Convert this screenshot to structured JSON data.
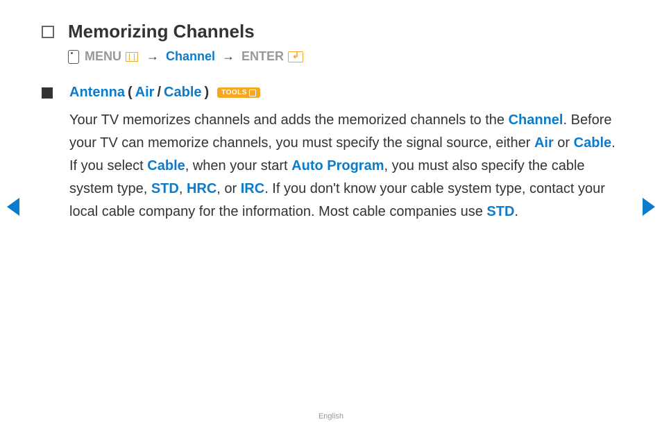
{
  "title": "Memorizing Channels",
  "nav": {
    "menu": "MENU",
    "channel": "Channel",
    "enter": "ENTER",
    "arrow": "→"
  },
  "section": {
    "antenna": "Antenna",
    "open_paren": "(",
    "air": "Air",
    "slash": " / ",
    "cable": "Cable",
    "close_paren": ")",
    "tools": "TOOLS"
  },
  "body": {
    "t1": "Your TV memorizes channels and adds the memorized channels to the ",
    "channel": "Channel",
    "t2": ". Before your TV can memorize channels, you must specify the signal source, either ",
    "air": "Air",
    "t3": " or ",
    "cable": "Cable",
    "t4": ". If you select ",
    "cable2": "Cable",
    "t5": ", when your start ",
    "autoprogram": "Auto Program",
    "t6": ", you must also specify the cable system type, ",
    "std": "STD",
    "t7": ", ",
    "hrc": "HRC",
    "t8": ", or ",
    "irc": "IRC",
    "t9": ". If you don't know your cable system type, contact your local cable company for the information. Most cable companies use ",
    "std2": "STD",
    "t10": "."
  },
  "footer": "English"
}
